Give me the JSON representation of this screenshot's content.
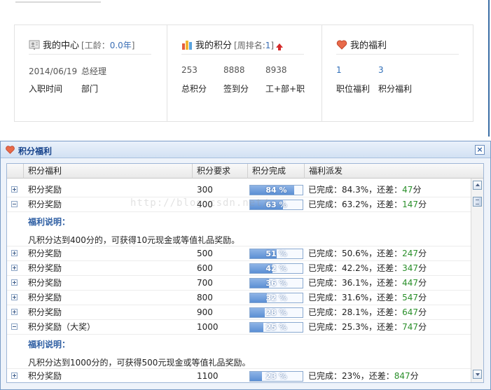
{
  "summary": {
    "my_center": {
      "title": "我的中心",
      "sub_prefix": "[工龄：",
      "sub_value": "0.0年",
      "sub_suffix": "]",
      "date": "2014/06/19",
      "position": "总经理",
      "label_join": "入职时间",
      "label_dept": "部门"
    },
    "my_points": {
      "title": "我的积分",
      "sub_prefix": "[周排名:",
      "sub_value": "1",
      "sub_suffix": "]",
      "values": [
        "253",
        "8888",
        "8938"
      ],
      "labels": [
        "总积分",
        "签到分",
        "工+部+职"
      ]
    },
    "my_welfare": {
      "title": "我的福利",
      "values": [
        "1",
        "3"
      ],
      "labels": [
        "职位福利",
        "积分福利"
      ]
    }
  },
  "dialog": {
    "title": "积分福利",
    "columns": [
      "积分福利",
      "积分要求",
      "积分完成",
      "福利派发"
    ],
    "detail_title": "福利说明：",
    "rows": [
      {
        "name": "积分奖励",
        "req": "300",
        "pct": 84,
        "pct_label": "84 %",
        "done": "84.3%",
        "diff": "47",
        "expanded": false
      },
      {
        "name": "积分奖励",
        "req": "400",
        "pct": 63,
        "pct_label": "63 %",
        "done": "63.2%",
        "diff": "147",
        "expanded": true,
        "detail": "凡积分达到400分的，可获得10元现金或等值礼品奖励。"
      },
      {
        "name": "积分奖励",
        "req": "500",
        "pct": 51,
        "pct_label": "51 %",
        "done": "50.6%",
        "diff": "247",
        "expanded": false
      },
      {
        "name": "积分奖励",
        "req": "600",
        "pct": 42,
        "pct_label": "42 %",
        "done": "42.2%",
        "diff": "347",
        "expanded": false
      },
      {
        "name": "积分奖励",
        "req": "700",
        "pct": 36,
        "pct_label": "36 %",
        "done": "36.1%",
        "diff": "447",
        "expanded": false
      },
      {
        "name": "积分奖励",
        "req": "800",
        "pct": 32,
        "pct_label": "32 %",
        "done": "31.6%",
        "diff": "547",
        "expanded": false
      },
      {
        "name": "积分奖励",
        "req": "900",
        "pct": 28,
        "pct_label": "28 %",
        "done": "28.1%",
        "diff": "647",
        "expanded": false
      },
      {
        "name": "积分奖励（大奖）",
        "req": "1000",
        "pct": 25,
        "pct_label": "25 %",
        "done": "25.3%",
        "diff": "747",
        "expanded": true,
        "detail": "凡积分达到1000分的，可获得500元现金或等值礼品奖励。"
      },
      {
        "name": "积分奖励",
        "req": "1100",
        "pct": 23,
        "pct_label": "23 %",
        "done": "23%",
        "diff": "847",
        "expanded": false
      }
    ],
    "status_done_prefix": "已完成：",
    "status_diff_prefix": "，还差：",
    "status_suffix": "分"
  },
  "watermark": "http://blog.csdn.net/...",
  "colors": {
    "accent": "#15428b",
    "link": "#2f6eb8",
    "progress": "#5b8fd4",
    "diff": "#2a8f2a",
    "arrow": "#d42a2a"
  }
}
